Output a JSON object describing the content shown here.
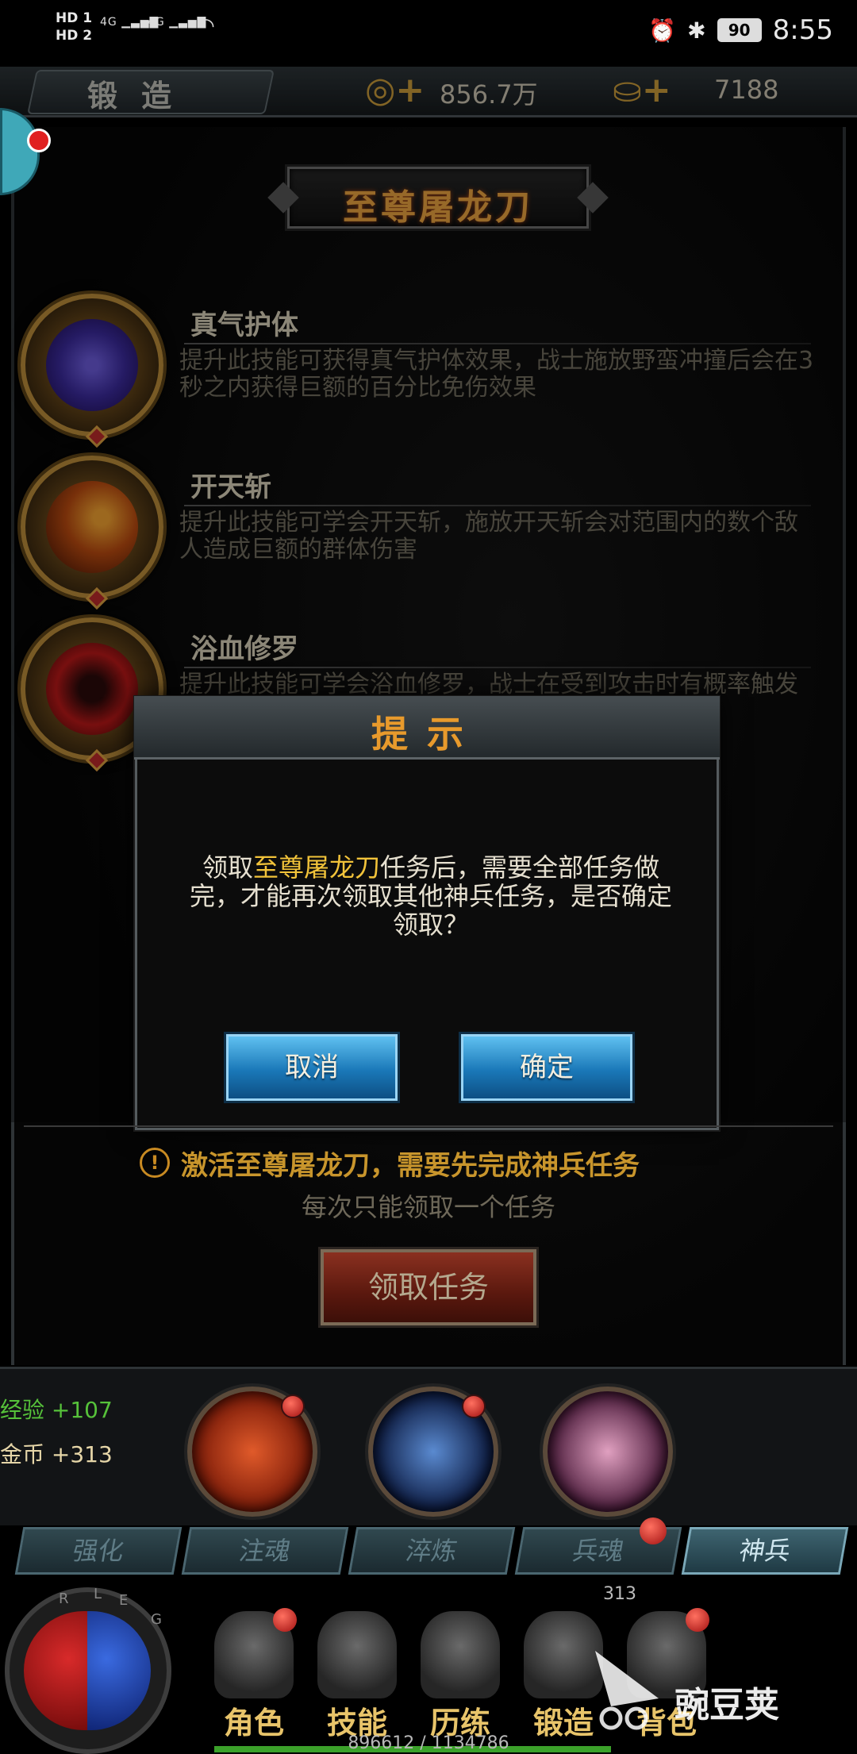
{
  "status_bar": {
    "sim1": "HD 1",
    "sim2": "HD 2",
    "net1": "4G",
    "net2": "4G",
    "battery": "90",
    "time": "8:55"
  },
  "topbar": {
    "tab_label": "锻造",
    "currency1_value": "856.7万",
    "currency2_value": "7188"
  },
  "item_title": "至尊屠龙刀",
  "skills": [
    {
      "name": "真气护体",
      "desc": "提升此技能可获得真气护体效果，战士施放野蛮冲撞后会在3秒之内获得巨额的百分比免伤效果"
    },
    {
      "name": "开天斩",
      "desc": "提升此技能可学会开天斩，施放开天斩会对范围内的数个敌人造成巨额的群体伤害"
    },
    {
      "name": "浴血修罗",
      "desc": "提升此技能可学会浴血修罗，战士在受到攻击时有概率触发浴血修罗，将一部分伤害转化为气血吸收"
    }
  ],
  "dialog": {
    "title": "提示",
    "msg_before": "领取",
    "msg_highlight": "至尊屠龙刀",
    "msg_after": "任务后，需要全部任务做完，才能再次领取其他神兵任务，是否确定领取？",
    "cancel": "取消",
    "confirm": "确定"
  },
  "notice": {
    "warning": "激活至尊屠龙刀，需要先完成神兵任务",
    "sub": "每次只能领取一个任务",
    "claim_button": "领取任务"
  },
  "rewards": {
    "exp": "经验 +107",
    "gold": "金币  +313"
  },
  "tabs": [
    "强化",
    "注魂",
    "淬炼",
    "兵魂",
    "神兵"
  ],
  "active_tab": "神兵",
  "level": "313",
  "nav": [
    "角色",
    "技能",
    "历练",
    "锻造",
    "背包"
  ],
  "xp": "896612 / 1134786",
  "watermark": "豌豆荚",
  "colors": {
    "title_orange": "#e89a2c",
    "highlight_yellow": "#f2c33a",
    "button_blue": "#1a78b8",
    "claim_red": "#5a180e",
    "exp_green": "#56c23a"
  }
}
